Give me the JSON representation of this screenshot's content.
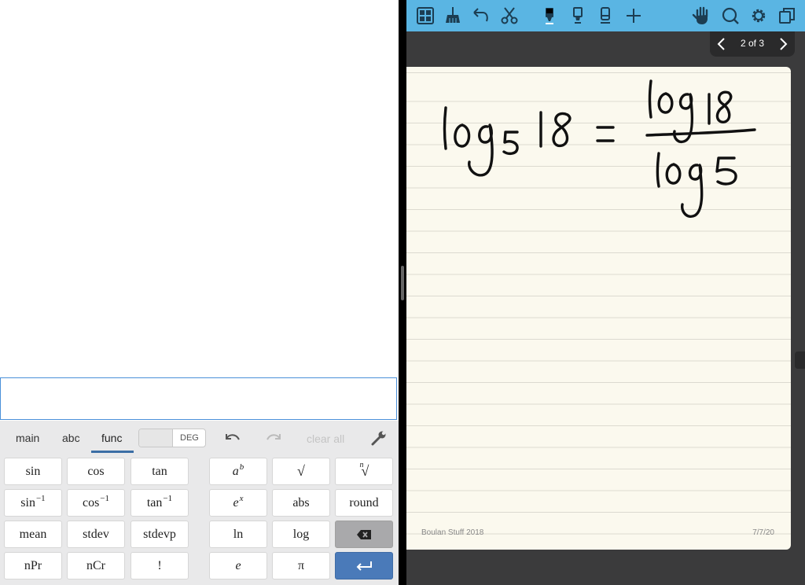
{
  "calculator": {
    "input_value": "",
    "tabs": [
      {
        "label": "main",
        "active": false
      },
      {
        "label": "abc",
        "active": false
      },
      {
        "label": "func",
        "active": true
      }
    ],
    "angle_mode": "DEG",
    "clear_all_label": "clear all",
    "icons": [
      "undo-icon",
      "redo-icon",
      "wrench-icon",
      "backspace-icon",
      "enter-icon"
    ],
    "keys": {
      "sin": "sin",
      "cos": "cos",
      "tan": "tan",
      "arcsin": "sin",
      "arccos": "cos",
      "arctan": "tan",
      "inverse_exp": "−1",
      "mean": "mean",
      "stdev": "stdev",
      "stdevp": "stdevp",
      "npr": "nPr",
      "ncr": "nCr",
      "factorial": "!",
      "power_base": "a",
      "power_exp": "b",
      "sqrt": "√",
      "nthroot_index": "n",
      "nthroot": "√",
      "exp_base": "e",
      "exp_power": "x",
      "abs": "abs",
      "round": "round",
      "ln": "ln",
      "log": "log",
      "e": "e",
      "pi": "π"
    }
  },
  "notes_app": {
    "toolbar_icons": [
      "grid-icon",
      "broom-icon",
      "undo-icon",
      "scissors-icon",
      "pen-icon",
      "highlighter-icon",
      "eraser-icon",
      "plus-icon",
      "hand-icon",
      "search-icon",
      "gear-icon",
      "duplicate-icon"
    ],
    "accent_color": "#5ab5e3",
    "page_indicator": "2 of 3",
    "handwriting": "log5 18 = log 18 / log 5",
    "footer_left": "Boulan Stuff 2018",
    "footer_right": "7/7/20"
  }
}
